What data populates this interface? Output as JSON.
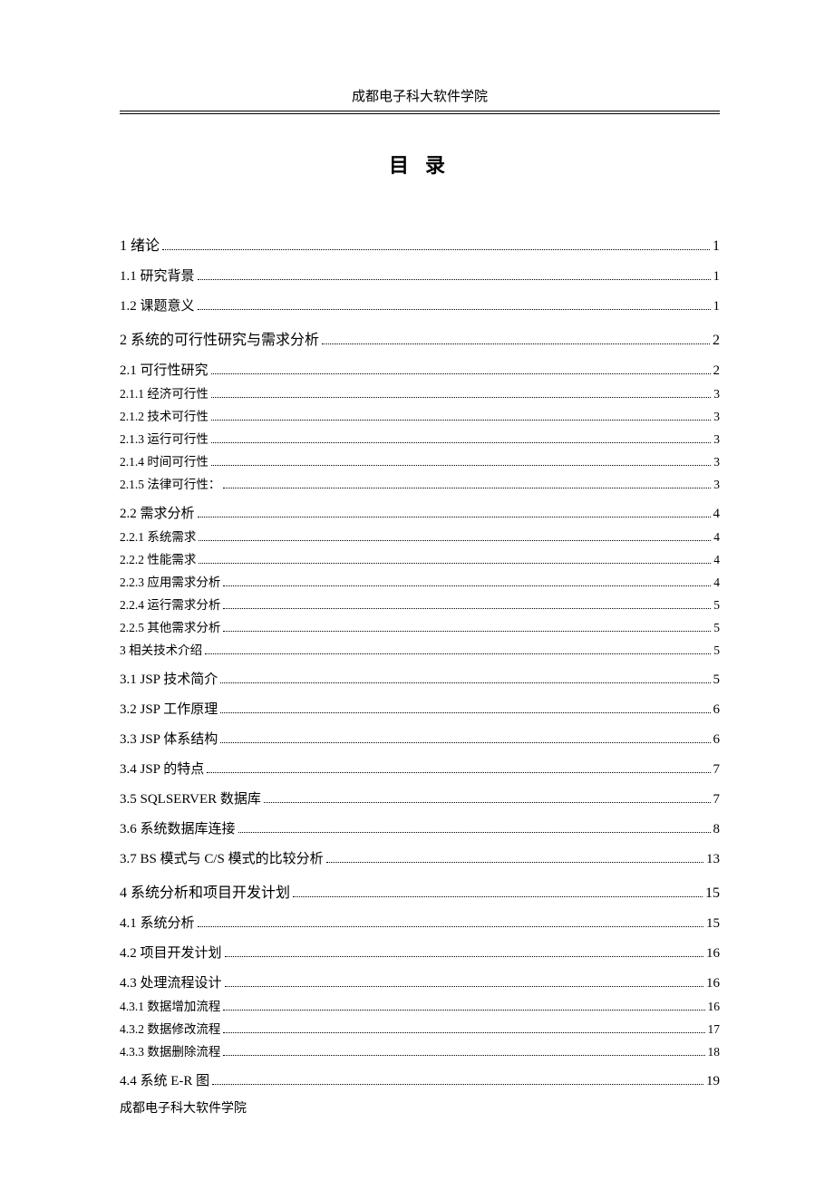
{
  "header": "成都电子科大软件学院",
  "title": "目 录",
  "footer": "成都电子科大软件学院",
  "toc": [
    {
      "label": "1 绪论",
      "page": "1",
      "level": "level1"
    },
    {
      "label": "1.1  研究背景",
      "page": "1",
      "level": "level2"
    },
    {
      "label": "1.2  课题意义",
      "page": "1",
      "level": "level2"
    },
    {
      "label": "2 系统的可行性研究与需求分析",
      "page": "2",
      "level": "level1"
    },
    {
      "label": "2.1  可行性研究",
      "page": "2",
      "level": "level2"
    },
    {
      "label": "2.1.1 经济可行性",
      "page": "3",
      "level": "level3"
    },
    {
      "label": "2.1.2 技术可行性",
      "page": "3",
      "level": "level3"
    },
    {
      "label": "2.1.3 运行可行性",
      "page": "3",
      "level": "level3"
    },
    {
      "label": "2.1.4 时间可行性",
      "page": "3",
      "level": "level3"
    },
    {
      "label": "2.1.5 法律可行性：",
      "page": "3",
      "level": "level3"
    },
    {
      "label": "2.2  需求分析",
      "page": "4",
      "level": "level2"
    },
    {
      "label": "2.2.1 系统需求",
      "page": "4",
      "level": "level3"
    },
    {
      "label": "2.2.2 性能需求",
      "page": "4",
      "level": "level3"
    },
    {
      "label": "2.2.3 应用需求分析",
      "page": "4",
      "level": "level3"
    },
    {
      "label": "2.2.4 运行需求分析",
      "page": "5",
      "level": "level3"
    },
    {
      "label": "2.2.5 其他需求分析",
      "page": "5",
      "level": "level3"
    },
    {
      "label": "3 相关技术介绍",
      "page": "5",
      "level": "level3b"
    },
    {
      "label": "3.1 JSP 技术简介",
      "page": "5",
      "level": "level2"
    },
    {
      "label": "3.2 JSP 工作原理",
      "page": "6",
      "level": "level2"
    },
    {
      "label": "3.3 JSP 体系结构",
      "page": "6",
      "level": "level2"
    },
    {
      "label": "3.4 JSP 的特点",
      "page": "7",
      "level": "level2"
    },
    {
      "label": "3.5 SQLSERVER  数据库",
      "page": "7",
      "level": "level2"
    },
    {
      "label": "3.6  系统数据库连接",
      "page": "8",
      "level": "level2"
    },
    {
      "label": "3.7 BS 模式与 C/S 模式的比较分析",
      "page": "13",
      "level": "level2"
    },
    {
      "label": "4 系统分析和项目开发计划",
      "page": "15",
      "level": "level1"
    },
    {
      "label": "4.1  系统分析",
      "page": "15",
      "level": "level2"
    },
    {
      "label": "4.2  项目开发计划",
      "page": "16",
      "level": "level2"
    },
    {
      "label": "4.3  处理流程设计",
      "page": "16",
      "level": "level2"
    },
    {
      "label": "4.3.1 数据增加流程",
      "page": "16",
      "level": "level3"
    },
    {
      "label": "4.3.2 数据修改流程",
      "page": "17",
      "level": "level3"
    },
    {
      "label": "4.3.3 数据删除流程",
      "page": "18",
      "level": "level3"
    },
    {
      "label": "4.4  系统 E-R 图",
      "page": "19",
      "level": "level2"
    }
  ]
}
